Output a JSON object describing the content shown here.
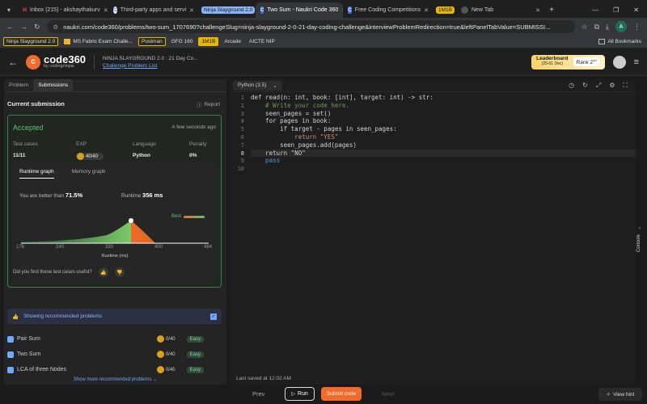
{
  "browser": {
    "tabs": [
      {
        "label": "Inbox (215) - akshaythakurv",
        "icon": "gmail-icon",
        "color": "#ea4335"
      },
      {
        "label": "Third-party apps and servi",
        "icon": "google-icon",
        "color": "#4285f4"
      },
      {
        "label": "Ninja Slayground 2.0",
        "icon": "",
        "color": "#3b6df0"
      },
      {
        "label": "Two Sum - Naukri Code 360",
        "icon": "codestudio-icon",
        "color": "#3b6df0"
      },
      {
        "label": "Free Coding Competitions",
        "icon": "codestudio-icon",
        "color": "#3b6df0"
      },
      {
        "label": "1M1B",
        "icon": "",
        "color": "#e6b800"
      },
      {
        "label": "New Tab",
        "icon": "chrome-icon",
        "color": "#888"
      }
    ],
    "url": "naukri.com/code360/problems/two-sum_1707690?challengeSlug=ninja-slayground-2-0-21-day-coding-challenge&interviewProblemRedirection=true&leftPanelTabValue=SUBMISSI...",
    "avatar_letter": "A",
    "bookmarks": [
      "Ninja Slayground 2.0",
      "MS Fabric Exam Challe...",
      "Postman",
      "GFG 160",
      "1M1B",
      "Arcade",
      "AICTE NIP"
    ],
    "all_bookmarks": "All Bookmarks"
  },
  "header": {
    "logo_main": "code360",
    "logo_sub": "by codingninjas",
    "title": "NINJA SLAYGROUND 2.0 : 21 Day Co...",
    "subtitle": "Challenge Problem List",
    "leaderboard": "Leaderboard",
    "leaderboard_date": "(25-01 Dec)",
    "rank": "Rank 2",
    "rank_sup": "nd"
  },
  "left": {
    "tabs": [
      "Problem",
      "Submissions"
    ],
    "current_submission": "Current submission",
    "report": "Report",
    "status": "Accepted",
    "time_ago": "A few seconds ago",
    "stats_labels": [
      "Test cases",
      "EXP",
      "Language",
      "Penalty"
    ],
    "stats_values": [
      "11/11",
      "40/40",
      "Python",
      "0%"
    ],
    "graph_tabs": [
      "Runtime graph",
      "Memory graph"
    ],
    "better_than_label": "You are better than",
    "better_than_value": "71.5%",
    "runtime_label": "Runtime",
    "runtime_value": "356 ms",
    "best_label": "Best",
    "x_ticks": [
      "176",
      "240",
      "320",
      "400",
      "484"
    ],
    "x_label": "Runtime (ms)",
    "feedback_q": "Did you find these test cases useful?",
    "recommended_toggle": "Showing recommended problems",
    "problems": [
      {
        "name": "Pair Sum",
        "exp": "0/40",
        "difficulty": "Easy"
      },
      {
        "name": "Two Sum",
        "exp": "0/40",
        "difficulty": "Easy"
      },
      {
        "name": "LCA of three Nodes",
        "exp": "0/40",
        "difficulty": "Easy"
      }
    ],
    "show_more": "Show more recommended problems"
  },
  "editor": {
    "language": "Python (3.5)",
    "lines": [
      "def read(n: int, book: [int], target: int) -> str:",
      "    # Write your code here.",
      "    seen_pages = set()",
      "    for pages in book:",
      "        if target - pages in seen_pages:",
      "            return \"YES\"",
      "        seen_pages.add(pages)",
      "    return \"NO\"",
      "    pass",
      ""
    ],
    "last_saved": "Last saved at 12:02 AM",
    "console_label": "Console"
  },
  "bottom": {
    "prev": "Prev",
    "run": "Run",
    "submit": "Submit code",
    "next": "Next",
    "hint": "View hint"
  },
  "colors": {
    "accent": "#f26b2c",
    "accepted": "#5cc46b",
    "panel": "#242424"
  }
}
